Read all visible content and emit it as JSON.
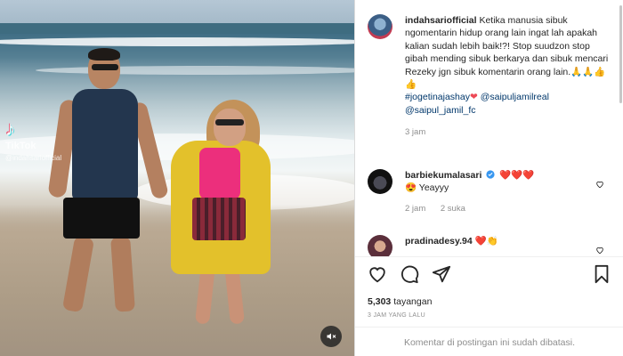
{
  "media": {
    "watermark_app": "TikTok",
    "watermark_handle": "@indahsariofficial",
    "mute_icon": "speaker-muted-icon"
  },
  "post": {
    "author": "indahsariofficial",
    "caption": "Ketika manusia sibuk ngomentarin hidup orang lain ingat lah apakah kalian sudah lebih baik!?! Stop suudzon stop gibah mending sibuk berkarya dan sibuk mencari Rezeky jgn sibuk komentarin orang lain.🙏🙏👍👍",
    "hashtag": "#jogetinajashay",
    "heart": "❤",
    "mention1": "@saipuljamilreal",
    "mention2": "@saipul_jamil_fc",
    "time": "3 jam"
  },
  "comments": [
    {
      "user": "barbiekumalasari",
      "hearts": "❤️❤️❤️",
      "text": "😍 Yeayyy",
      "time": "2 jam",
      "likes": "2 suka"
    },
    {
      "user": "pradinadesy.94",
      "hearts": "❤️👏",
      "text": ""
    }
  ],
  "actions": {
    "views_count": "5,303",
    "views_label": "tayangan",
    "posted_ago": "3 JAM YANG LALU",
    "comments_disabled": "Komentar di postingan ini sudah dibatasi."
  },
  "colors": {
    "link": "#00376b",
    "muted": "#8e8e8e",
    "verified": "#3897f0"
  }
}
